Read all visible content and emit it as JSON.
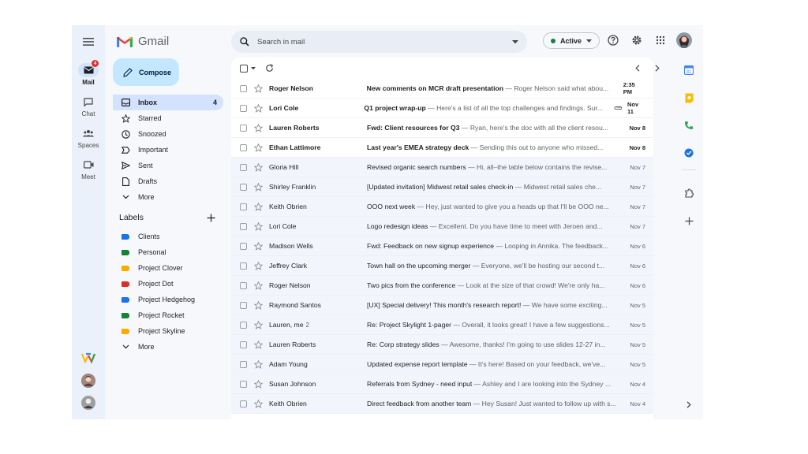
{
  "app": {
    "name": "Gmail"
  },
  "rail": {
    "items": [
      {
        "label": "Mail",
        "badge": "4"
      },
      {
        "label": "Chat"
      },
      {
        "label": "Spaces"
      },
      {
        "label": "Meet"
      }
    ]
  },
  "nav": {
    "compose_label": "Compose",
    "items": [
      {
        "label": "Inbox",
        "count": "4",
        "icon": "inbox-icon"
      },
      {
        "label": "Starred",
        "icon": "star-icon"
      },
      {
        "label": "Snoozed",
        "icon": "clock-icon"
      },
      {
        "label": "Important",
        "icon": "important-icon"
      },
      {
        "label": "Sent",
        "icon": "send-icon"
      },
      {
        "label": "Drafts",
        "icon": "draft-icon"
      },
      {
        "label": "More",
        "icon": "chevron-down-icon"
      }
    ],
    "labels_title": "Labels",
    "labels": [
      {
        "label": "Clients",
        "color": "#1a73e8"
      },
      {
        "label": "Personal",
        "color": "#188038"
      },
      {
        "label": "Project Clover",
        "color": "#f9ab00"
      },
      {
        "label": "Project Dot",
        "color": "#d93025"
      },
      {
        "label": "Project Hedgehog",
        "color": "#1a73e8"
      },
      {
        "label": "Project Rocket",
        "color": "#188038"
      },
      {
        "label": "Project Skyline",
        "color": "#f9ab00"
      }
    ],
    "labels_more": "More"
  },
  "search": {
    "placeholder": "Search in mail"
  },
  "status": {
    "label": "Active",
    "color": "#188038"
  },
  "emails": [
    {
      "sender": "Roger Nelson",
      "subject": "New comments on MCR draft presentation",
      "snippet": " — Roger Nelson said what abou...",
      "date": "2:35 PM",
      "unread": true
    },
    {
      "sender": "Lori Cole",
      "subject": "Q1 project wrap-up",
      "snippet": " — Here's a list of all the top challenges and findings. Sur...",
      "date": "Nov 11",
      "unread": true,
      "attachment": true
    },
    {
      "sender": "Lauren Roberts",
      "subject": "Fwd: Client resources for Q3",
      "snippet": " — Ryan, here's the doc with all the client resou...",
      "date": "Nov 8",
      "unread": true
    },
    {
      "sender": "Ethan Lattimore",
      "subject": "Last year's EMEA strategy deck",
      "snippet": " — Sending this out to anyone who missed...",
      "date": "Nov 8",
      "unread": true
    },
    {
      "sender": "Gloria Hill",
      "subject": "Revised organic search numbers",
      "snippet": " — Hi, all–the table below contains the revise...",
      "date": "Nov 7",
      "unread": false
    },
    {
      "sender": "Shirley Franklin",
      "subject": "[Updated invitation] Midwest retail sales check-in",
      "snippet": " — Midwest retail sales che...",
      "date": "Nov 7",
      "unread": false
    },
    {
      "sender": "Keith Obrien",
      "subject": "OOO next week",
      "snippet": " — Hey, just wanted to give you a heads up that I'll be OOO ne...",
      "date": "Nov 7",
      "unread": false
    },
    {
      "sender": "Lori Cole",
      "subject": "Logo redesign ideas",
      "snippet": " — Excellent. Do you have time to meet with Jeroen and...",
      "date": "Nov 7",
      "unread": false
    },
    {
      "sender": "Madison Wells",
      "subject": "Fwd: Feedback on new signup experience",
      "snippet": " — Looping in Annika. The feedback...",
      "date": "Nov 6",
      "unread": false
    },
    {
      "sender": "Jeffrey Clark",
      "subject": "Town hall on the upcoming merger",
      "snippet": " — Everyone, we'll be hosting our second t...",
      "date": "Nov 6",
      "unread": false
    },
    {
      "sender": "Roger Nelson",
      "subject": "Two pics from the conference",
      "snippet": " — Look at the size of that crowd! We're only ha...",
      "date": "Nov 6",
      "unread": false
    },
    {
      "sender": "Raymond Santos",
      "subject": "[UX] Special delivery! This month's research report!",
      "snippet": " — We have some exciting...",
      "date": "Nov 5",
      "unread": false
    },
    {
      "sender": "Lauren, me",
      "count": "2",
      "subject": "Re: Project Skylight 1-pager",
      "snippet": " — Overall, it looks great! I have a few suggestions...",
      "date": "Nov 5",
      "unread": false
    },
    {
      "sender": "Lauren Roberts",
      "subject": "Re: Corp strategy slides",
      "snippet": " — Awesome, thanks! I'm going to use slides 12-27 in...",
      "date": "Nov 5",
      "unread": false
    },
    {
      "sender": "Adam Young",
      "subject": "Updated expense report template",
      "snippet": " — It's here! Based on your feedback, we've...",
      "date": "Nov 5",
      "unread": false
    },
    {
      "sender": "Susan Johnson",
      "subject": "Referrals from Sydney - need input",
      "snippet": " — Ashley and I are looking into the Sydney ...",
      "date": "Nov 4",
      "unread": false
    },
    {
      "sender": "Keith Obrien",
      "subject": "Direct feedback from another team",
      "snippet": " — Hey Susan! Just wanted to follow up with s...",
      "date": "Nov 4",
      "unread": false
    }
  ],
  "colors": {
    "accent": "#0b57d0",
    "compose_bg": "#c2e7ff",
    "active_nav": "#d3e3fd",
    "badge": "#d93025"
  }
}
